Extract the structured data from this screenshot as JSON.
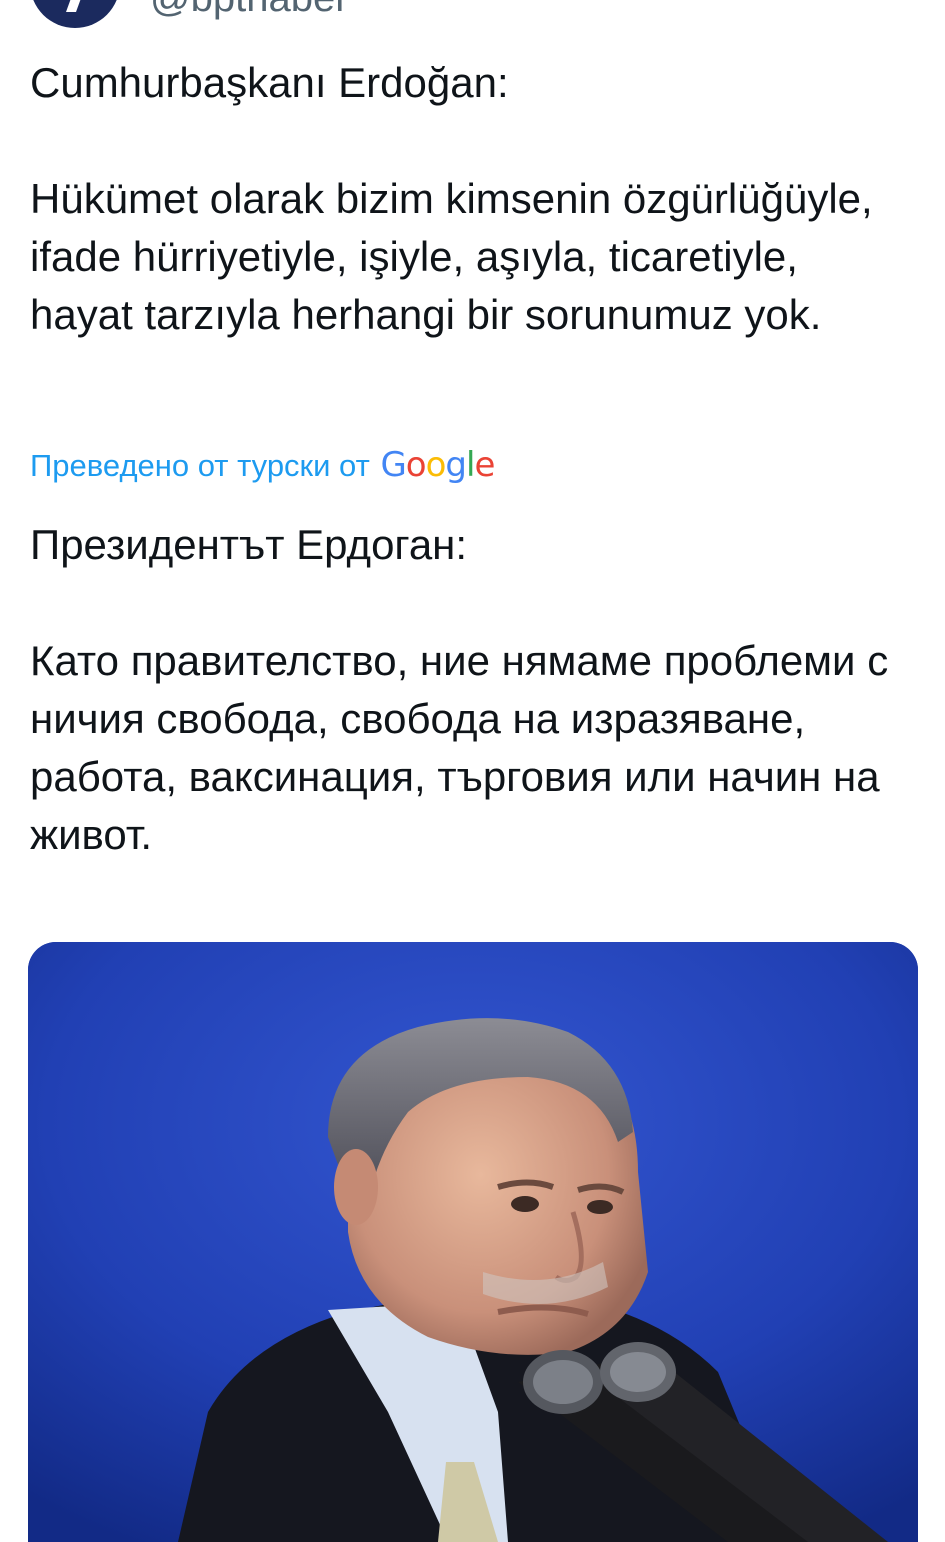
{
  "account": {
    "handle": "@bpthaber",
    "avatar_color": "#1b2a5e"
  },
  "tweet": {
    "original_text": "Cumhurbaşkanı Erdoğan:\n\nHükümet olarak bizim kimsenin özgürlüğüyle, ifade hürriyetiyle, işiyle, aşıyla, ticaretiyle, hayat tarzıyla herhangi bir sorunumuz yok.",
    "translation_note": "Преведено от турски от",
    "translation_provider": "Google",
    "translated_text": "Президентът Ердоган:\n\nКато правителство, ние нямаме проблеми с ничия свобода, свобода на изразяване, работа, ваксинация, търговия или начин на живот."
  },
  "media": {
    "background_color": "#1d3aa8"
  },
  "colors": {
    "link": "#1d9bf0",
    "text": "#0f1419",
    "muted": "#536471"
  }
}
